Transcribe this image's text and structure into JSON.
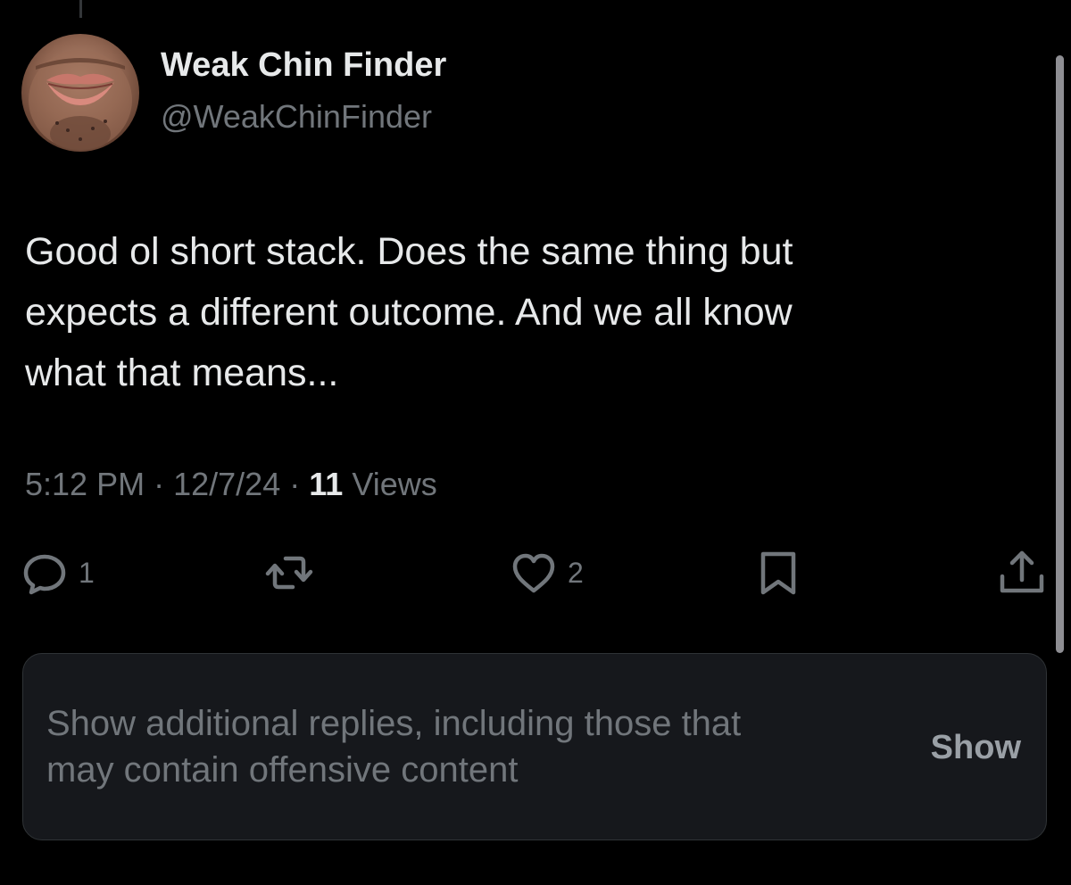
{
  "author": {
    "name": "Weak Chin Finder",
    "handle": "@WeakChinFinder"
  },
  "tweet": {
    "lines": [
      "Good ol short stack. Does the same thing but",
      "expects a different outcome. And we all know",
      "what that means..."
    ],
    "time": "5:12 PM",
    "separator": "·",
    "date": "12/7/24",
    "views_count": "11",
    "views_label": "Views"
  },
  "actions": {
    "reply_icon": "reply-icon",
    "reply_count": "1",
    "retweet_icon": "retweet-icon",
    "like_icon": "heart-icon",
    "like_count": "2",
    "bookmark_icon": "bookmark-icon",
    "share_icon": "share-icon"
  },
  "more_replies": {
    "lines": [
      "Show additional replies, including those that",
      "may contain offensive content"
    ],
    "button_label": "Show"
  },
  "colors": {
    "background": "#000000",
    "primary_text": "#e7e9ea",
    "secondary_text": "#71767b",
    "card_background": "#16181c"
  }
}
